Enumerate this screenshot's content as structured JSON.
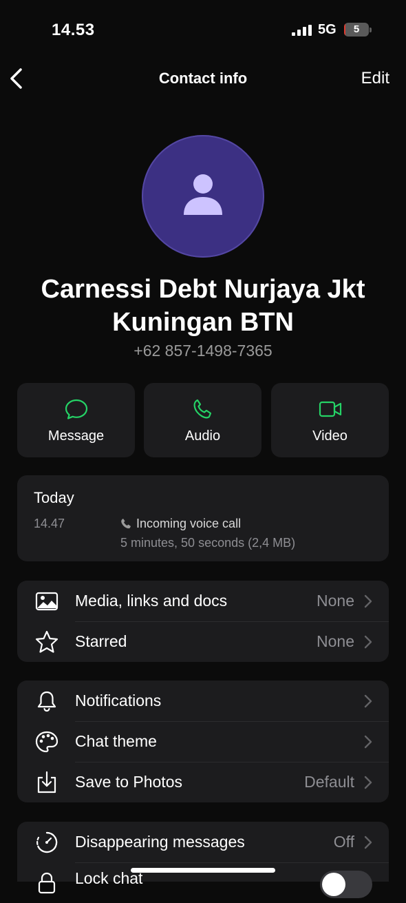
{
  "status_bar": {
    "time": "14.53",
    "network": "5G",
    "battery_level": "5",
    "battery_fraction": 0.05
  },
  "nav": {
    "title": "Contact info",
    "edit_label": "Edit"
  },
  "contact": {
    "name": "Carnessi Debt Nurjaya Jkt Kuningan BTN",
    "phone": "+62 857-1498-7365"
  },
  "actions": [
    {
      "label": "Message",
      "icon": "message-icon"
    },
    {
      "label": "Audio",
      "icon": "phone-icon"
    },
    {
      "label": "Video",
      "icon": "video-icon"
    }
  ],
  "calls": {
    "heading": "Today",
    "entries": [
      {
        "time": "14.47",
        "type": "Incoming voice call",
        "detail": "5 minutes, 50 seconds (2,4 MB)"
      }
    ]
  },
  "group1": [
    {
      "label": "Media, links and docs",
      "value": "None",
      "icon": "image-icon"
    },
    {
      "label": "Starred",
      "value": "None",
      "icon": "star-icon"
    }
  ],
  "group2": [
    {
      "label": "Notifications",
      "value": "",
      "icon": "bell-icon"
    },
    {
      "label": "Chat theme",
      "value": "",
      "icon": "palette-icon"
    },
    {
      "label": "Save to Photos",
      "value": "Default",
      "icon": "download-icon"
    }
  ],
  "group3": [
    {
      "label": "Disappearing messages",
      "value": "Off",
      "icon": "timer-icon"
    },
    {
      "label": "Lock chat",
      "icon": "lock-icon",
      "toggle_on": false
    }
  ],
  "colors": {
    "accent_green": "#25d366",
    "avatar_bg": "#3c3083",
    "avatar_fg": "#cdc3ff",
    "card_bg": "#1c1c1e"
  }
}
